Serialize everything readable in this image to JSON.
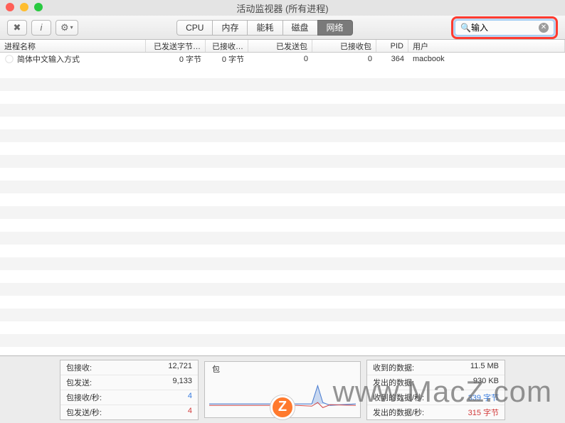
{
  "window": {
    "title": "活动监视器 (所有进程)"
  },
  "toolbar": {
    "stop_icon": "✖",
    "info_icon": "i",
    "gear_icon": "⚙"
  },
  "tabs": [
    {
      "label": "CPU",
      "active": false
    },
    {
      "label": "内存",
      "active": false
    },
    {
      "label": "能耗",
      "active": false
    },
    {
      "label": "磁盘",
      "active": false
    },
    {
      "label": "网络",
      "active": true
    }
  ],
  "search": {
    "placeholder": "",
    "value": "输入",
    "icon": "🔍"
  },
  "columns": {
    "name": "进程名称",
    "sent_bytes": "已发送字节…",
    "recv_bytes": "已接收…",
    "sent_pkts": "已发送包",
    "recv_pkts": "已接收包",
    "pid": "PID",
    "user": "用户"
  },
  "rows": [
    {
      "name": "简体中文输入方式",
      "sent_bytes": "0 字节",
      "recv_bytes": "0 字节",
      "sent_pkts": "0",
      "recv_pkts": "0",
      "pid": "364",
      "user": "macbook"
    }
  ],
  "footer_left": [
    {
      "label": "包接收:",
      "value": "12,721"
    },
    {
      "label": "包发送:",
      "value": "9,133"
    },
    {
      "label": "包接收/秒:",
      "value": "4"
    },
    {
      "label": "包发送/秒:",
      "value": "4"
    }
  ],
  "footer_mid": {
    "label": "包"
  },
  "footer_right": [
    {
      "label": "收到的数据:",
      "value": "11.5 MB"
    },
    {
      "label": "发出的数据:",
      "value": "930 KB"
    },
    {
      "label": "收到的数据/秒:",
      "value": "339 字节"
    },
    {
      "label": "发出的数据/秒:",
      "value": "315 字节"
    }
  ],
  "watermark": {
    "text": "www.MacZ.com",
    "badge": "Z"
  }
}
